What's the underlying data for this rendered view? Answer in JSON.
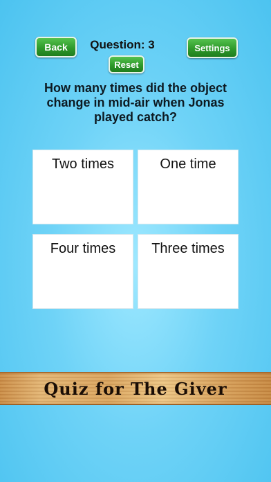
{
  "header": {
    "back_label": "Back",
    "question_number": "Question: 3",
    "settings_label": "Settings",
    "reset_label": "Reset"
  },
  "question": {
    "text": "How many times did the object change in mid-air when Jonas played catch?"
  },
  "answers": [
    {
      "label": "Two times"
    },
    {
      "label": "One time"
    },
    {
      "label": "Four times"
    },
    {
      "label": "Three times"
    }
  ],
  "banner": {
    "title": "Quiz for The Giver"
  },
  "colors": {
    "button_green": "#2f9a2b",
    "background_blue": "#4cc3f0",
    "banner_wood": "#d9a35e"
  }
}
